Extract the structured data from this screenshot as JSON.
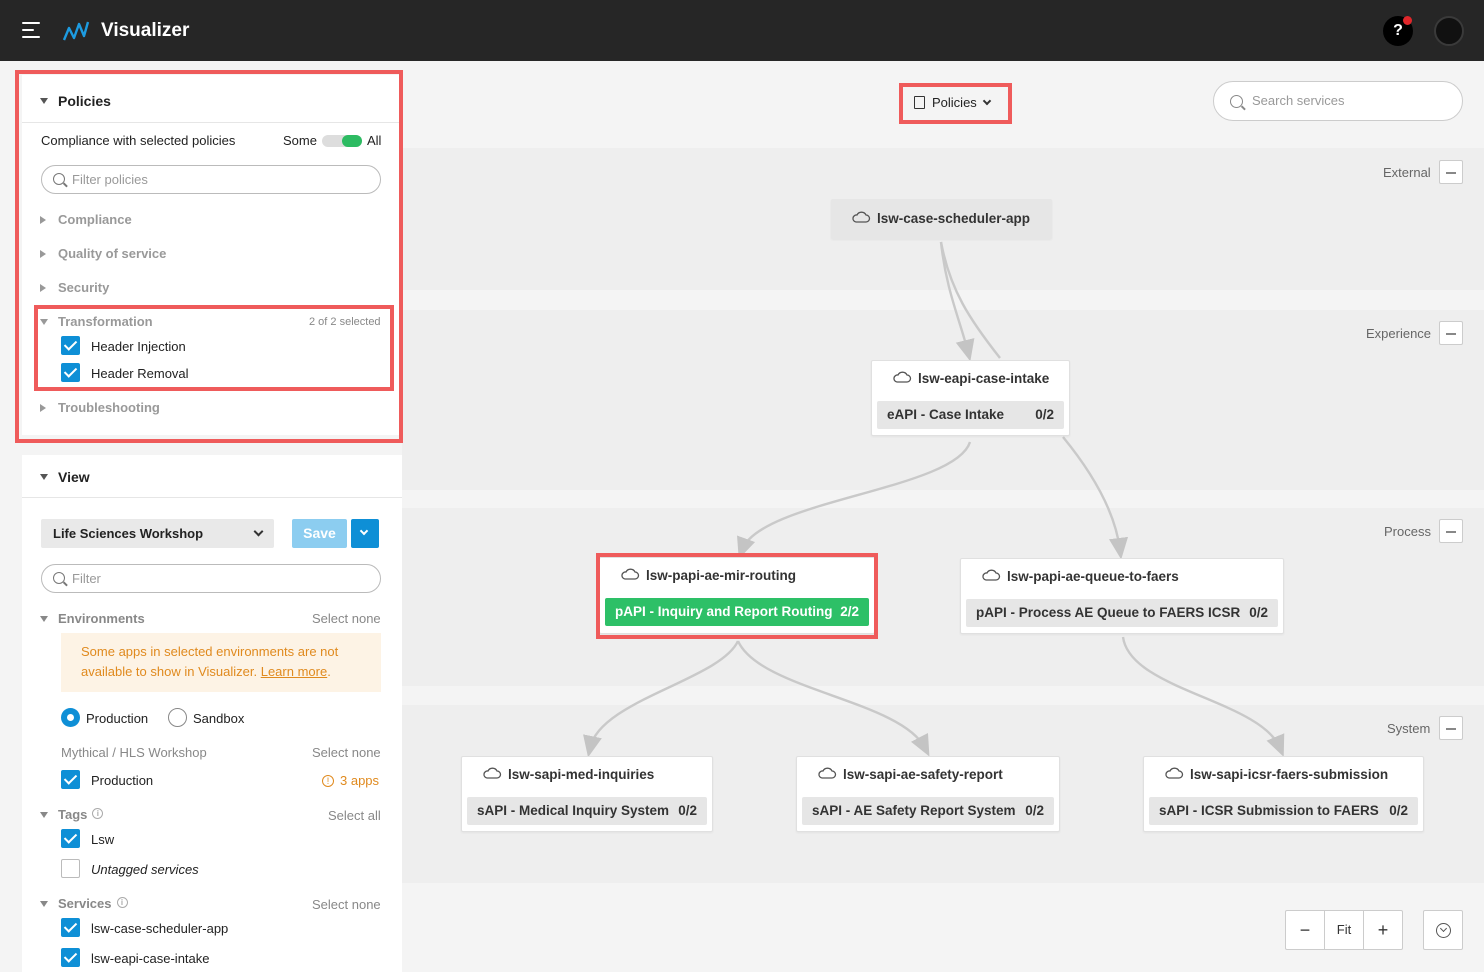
{
  "app": {
    "title": "Visualizer",
    "help_label": "?"
  },
  "policies_panel": {
    "heading": "Policies",
    "compliance_label": "Compliance with selected policies",
    "toggle_left": "Some",
    "toggle_right": "All",
    "filter_placeholder": "Filter policies",
    "categories": [
      {
        "label": "Compliance"
      },
      {
        "label": "Quality of service"
      },
      {
        "label": "Security"
      },
      {
        "label": "Transformation",
        "selected_count": "2 of 2 selected"
      },
      {
        "label": "Troubleshooting"
      }
    ],
    "transformation_items": [
      {
        "label": "Header Injection",
        "checked": true
      },
      {
        "label": "Header Removal",
        "checked": true
      }
    ]
  },
  "view_panel": {
    "heading": "View",
    "selected_view": "Life Sciences Workshop",
    "save_label": "Save",
    "filter_placeholder": "Filter",
    "environments": {
      "label": "Environments",
      "action": "Select none",
      "warning_text": "Some apps in selected environments are not available to show in Visualizer.",
      "warning_link": "Learn more",
      "warning_end": ".",
      "radio_production": "Production",
      "radio_sandbox": "Sandbox",
      "group_label": "Mythical / HLS Workshop",
      "group_action": "Select none",
      "env_item": "Production",
      "env_apps_warning": "3 apps"
    },
    "tags": {
      "label": "Tags",
      "action": "Select all",
      "items": [
        {
          "label": "Lsw",
          "checked": true
        },
        {
          "label": "Untagged services",
          "checked": false
        }
      ]
    },
    "services": {
      "label": "Services",
      "action": "Select none",
      "items": [
        {
          "label": "lsw-case-scheduler-app",
          "checked": true
        },
        {
          "label": "lsw-eapi-case-intake",
          "checked": true
        }
      ]
    }
  },
  "canvas": {
    "policies_button": "Policies",
    "search_placeholder": "Search services",
    "lanes": [
      "External",
      "Experience",
      "Process",
      "System"
    ],
    "nodes": {
      "scheduler": {
        "title": "lsw-case-scheduler-app"
      },
      "intake": {
        "title": "lsw-eapi-case-intake",
        "api": "eAPI - Case Intake",
        "count": "0/2"
      },
      "mir": {
        "title": "lsw-papi-ae-mir-routing",
        "api": "pAPI - Inquiry and Report Routing",
        "count": "2/2"
      },
      "faers_queue": {
        "title": "lsw-papi-ae-queue-to-faers",
        "api": "pAPI - Process AE Queue to FAERS ICSR",
        "count": "0/2"
      },
      "med_inq": {
        "title": "lsw-sapi-med-inquiries",
        "api": "sAPI - Medical Inquiry System",
        "count": "0/2"
      },
      "safety": {
        "title": "lsw-sapi-ae-safety-report",
        "api": "sAPI - AE Safety Report System",
        "count": "0/2"
      },
      "icsr": {
        "title": "lsw-sapi-icsr-faers-submission",
        "api": "sAPI - ICSR Submission to FAERS",
        "count": "0/2"
      }
    },
    "zoom": {
      "minus": "−",
      "fit": "Fit",
      "plus": "+"
    }
  },
  "colors": {
    "accent": "#0e8fd6",
    "success": "#2dc067",
    "highlight": "#ef5b5b",
    "topbar": "#262626"
  }
}
